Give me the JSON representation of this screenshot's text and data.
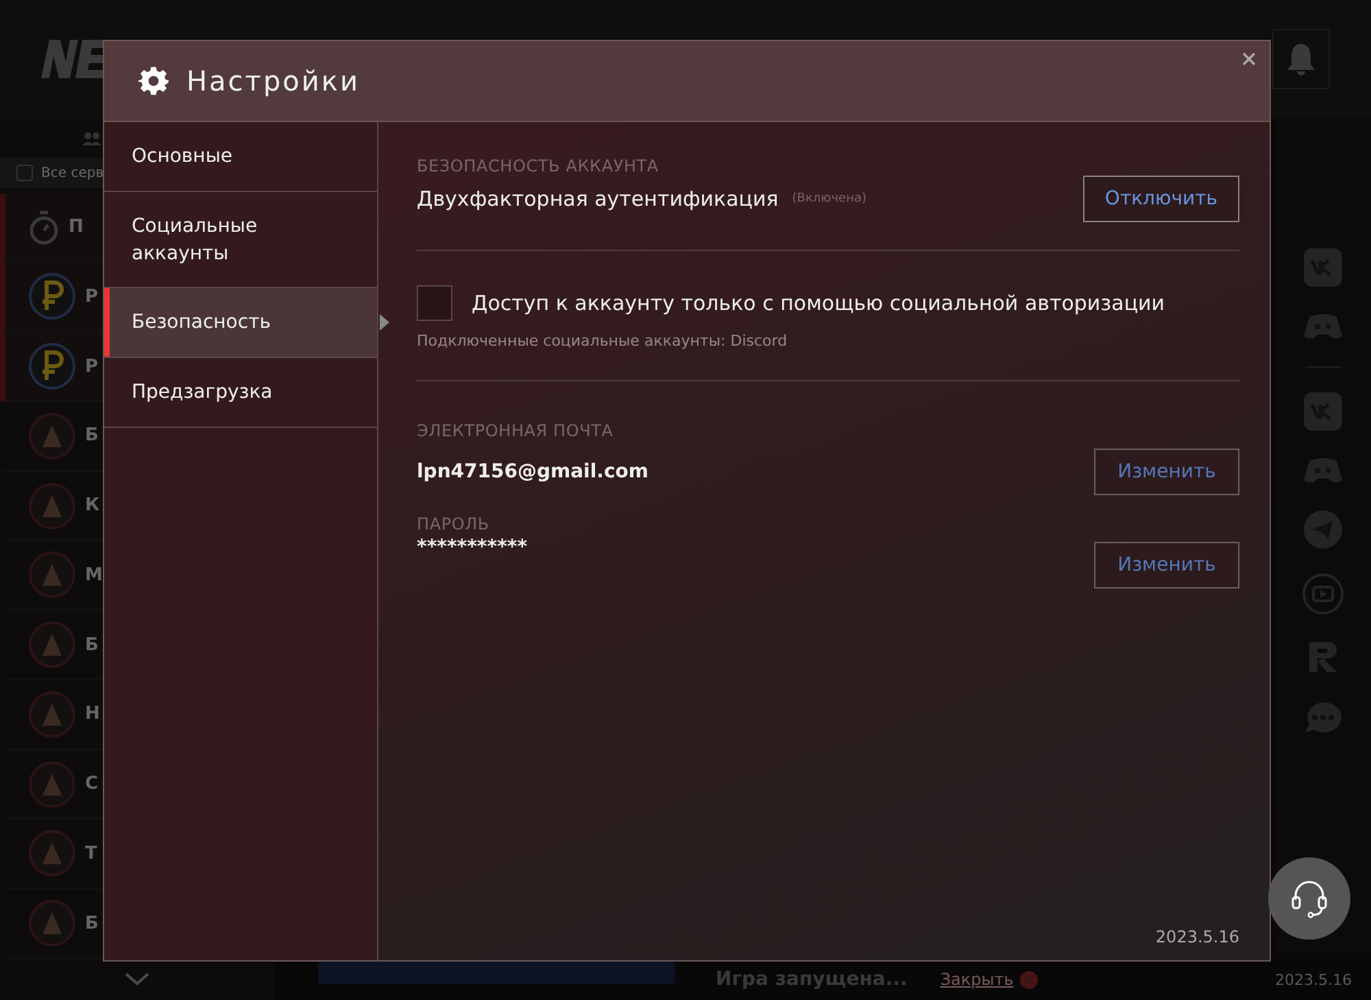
{
  "background": {
    "filter_label": "Все серв",
    "servers": [
      {
        "label": "П",
        "kind": "timer"
      },
      {
        "label": "Р",
        "kind": "ruble"
      },
      {
        "label": "Р",
        "kind": "ruble"
      },
      {
        "label": "Б",
        "kind": "server"
      },
      {
        "label": "К",
        "kind": "server"
      },
      {
        "label": "М",
        "kind": "server"
      },
      {
        "label": "Б",
        "kind": "server"
      },
      {
        "label": "Н",
        "kind": "server"
      },
      {
        "label": "С",
        "kind": "server"
      },
      {
        "label": "Т",
        "kind": "server"
      },
      {
        "label": "Б",
        "kind": "server"
      }
    ],
    "status": "Игра запущена...",
    "close_link": "Закрыть",
    "version": "2023.5.16"
  },
  "dialog": {
    "title": "Настройки",
    "nav": [
      {
        "label": "Основные",
        "selected": false
      },
      {
        "label": "Социальные аккаунты",
        "selected": false
      },
      {
        "label": "Безопасность",
        "selected": true
      },
      {
        "label": "Предзагрузка",
        "selected": false
      }
    ],
    "security": {
      "heading": "БЕЗОПАСНОСТЬ АККАУНТА",
      "two_factor": "Двухфакторная аутентификация",
      "two_factor_state": "(Включена)",
      "disable_button": "Отключить"
    },
    "social_only": {
      "label": "Доступ к аккаунту только с помощью социальной авторизации",
      "checked": false,
      "connected": "Подключенные социальные аккаунты: Discord"
    },
    "email": {
      "heading": "ЭЛЕКТРОННАЯ ПОЧТА",
      "value": "lpn47156@gmail.com",
      "button": "Изменить"
    },
    "password": {
      "heading": "ПАРОЛЬ",
      "value": "***********",
      "button": "Изменить"
    },
    "version": "2023.5.16"
  }
}
